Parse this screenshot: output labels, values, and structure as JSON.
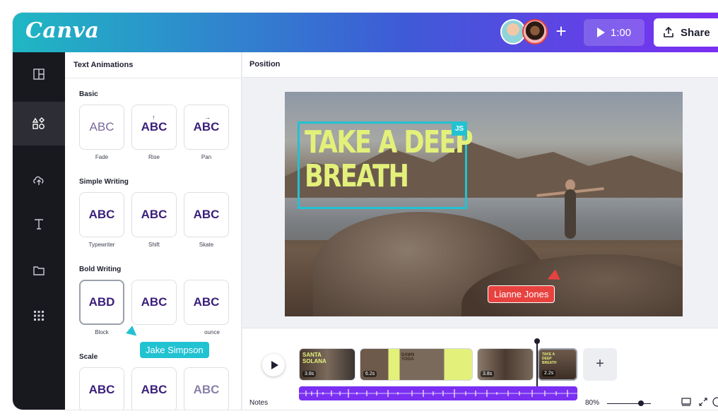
{
  "header": {
    "logo": "Canva",
    "play_duration": "1:00",
    "share_label": "Share",
    "add_collaborator": "+"
  },
  "panel": {
    "title": "Text Animations",
    "sections": [
      {
        "title": "Basic",
        "items": [
          {
            "label": "Fade",
            "sample": "ABC"
          },
          {
            "label": "Rise",
            "sample": "ABC"
          },
          {
            "label": "Pan",
            "sample": "ABC"
          }
        ]
      },
      {
        "title": "Simple Writing",
        "items": [
          {
            "label": "Typewriter",
            "sample": "ABC"
          },
          {
            "label": "Shift",
            "sample": "ABC"
          },
          {
            "label": "Skate",
            "sample": "ABC"
          }
        ]
      },
      {
        "title": "Bold Writing",
        "items": [
          {
            "label": "Block",
            "sample": "ABD"
          },
          {
            "label": "",
            "sample": "ABC"
          },
          {
            "label": "ounce",
            "sample": "ABC"
          }
        ]
      },
      {
        "title": "Scale",
        "items": [
          {
            "label": "",
            "sample": "ABC"
          },
          {
            "label": "",
            "sample": "ABC"
          },
          {
            "label": "",
            "sample": "ABC"
          }
        ]
      }
    ]
  },
  "editor": {
    "toolbar_label": "Position",
    "headline_line1": "TAKE A DEEP",
    "headline_line2": "BREATH",
    "js_badge": "JS",
    "collaborator_lianne": "Lianne Jones",
    "collaborator_jake": "Jake Simpson"
  },
  "timeline": {
    "clips": [
      {
        "duration": "3.8s",
        "title": "SANTA SOLANA"
      },
      {
        "duration": "6.2s",
        "title": "DAWN YOGA"
      },
      {
        "duration": "3.8s",
        "title": ""
      },
      {
        "duration": "2.2s",
        "title": "TAKE A DEEP BREATH"
      }
    ],
    "add_clip": "+",
    "notes_label": "Notes",
    "zoom_level": "80%"
  },
  "colors": {
    "accent_teal": "#21c2d2",
    "accent_purple": "#7b2ff2",
    "cursor_red": "#e8423f",
    "headline_yellow": "#e3f07a"
  }
}
